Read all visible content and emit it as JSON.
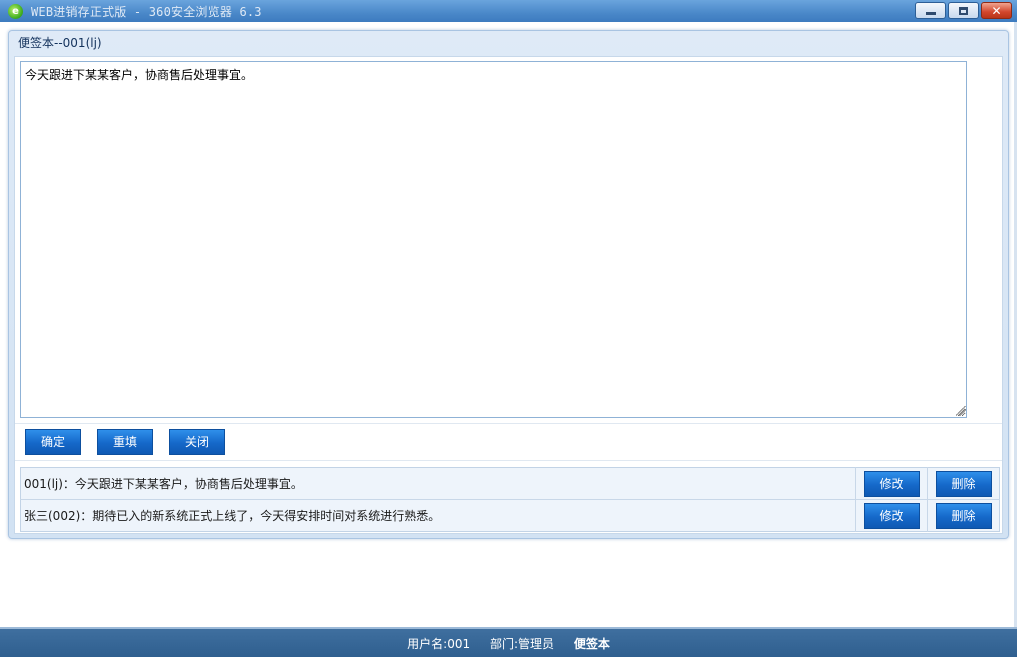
{
  "window": {
    "title": "WEB进销存正式版 - 360安全浏览器 6.3",
    "logo_glyph": "e",
    "close_glyph": "✕",
    "accent_color": "#4a88c9"
  },
  "dialog": {
    "title": "便签本--001(lj)",
    "textarea_value": "今天跟进下某某客户，协商售后处理事宜。",
    "buttons": {
      "confirm": "确定",
      "reset": "重填",
      "close": "关闭"
    },
    "button_color": "#1568c9"
  },
  "notes": [
    {
      "text": "001(lj)：今天跟进下某某客户，协商售后处理事宜。",
      "edit": "修改",
      "delete": "删除"
    },
    {
      "text": "张三(002)：期待已入的新系统正式上线了，今天得安排时间对系统进行熟悉。",
      "edit": "修改",
      "delete": "删除"
    }
  ],
  "status": {
    "user": "用户名:001",
    "department": "部门:管理员",
    "current": "便签本"
  }
}
